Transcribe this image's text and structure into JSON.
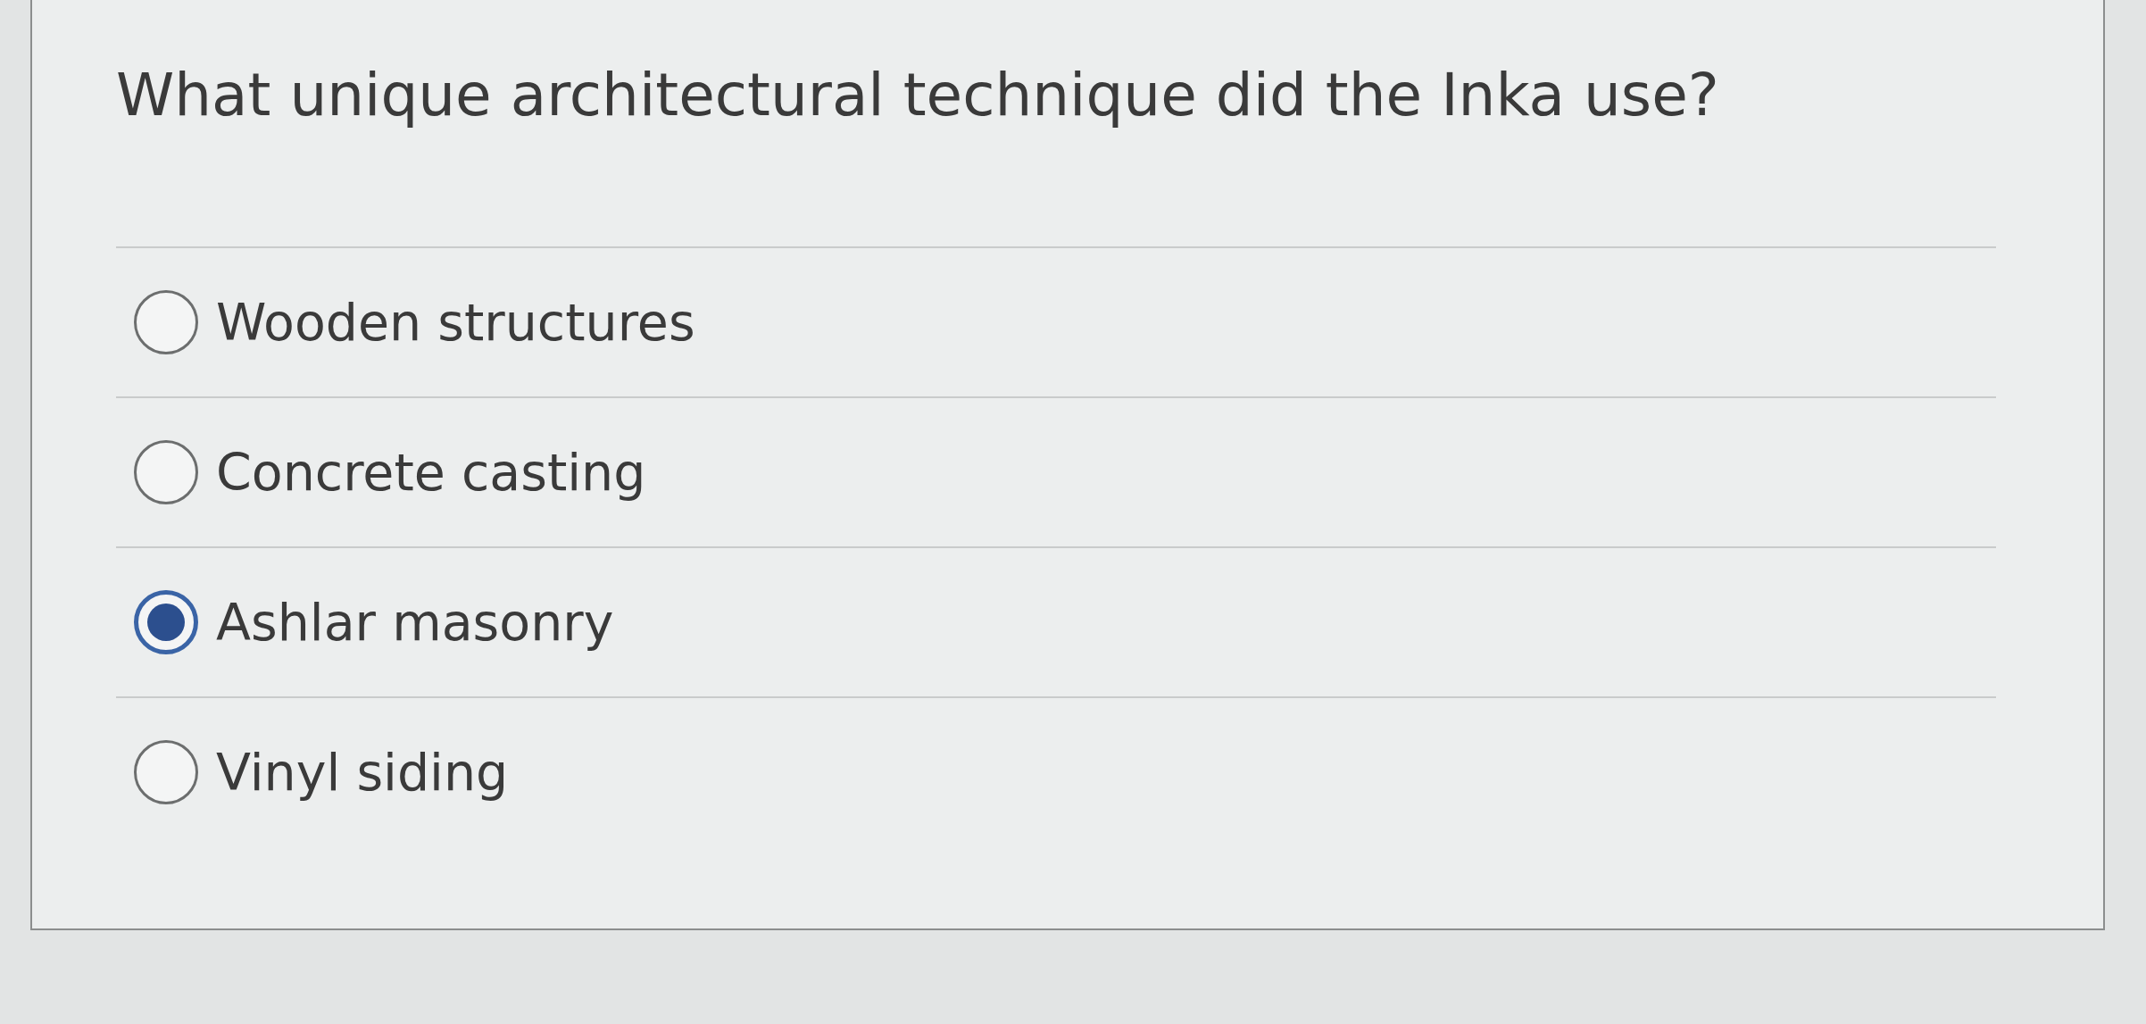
{
  "question": "What unique architectural technique did the Inka use?",
  "options": [
    {
      "label": "Wooden structures",
      "selected": false
    },
    {
      "label": "Concrete casting",
      "selected": false
    },
    {
      "label": "Ashlar masonry",
      "selected": true
    },
    {
      "label": "Vinyl siding",
      "selected": false
    }
  ]
}
